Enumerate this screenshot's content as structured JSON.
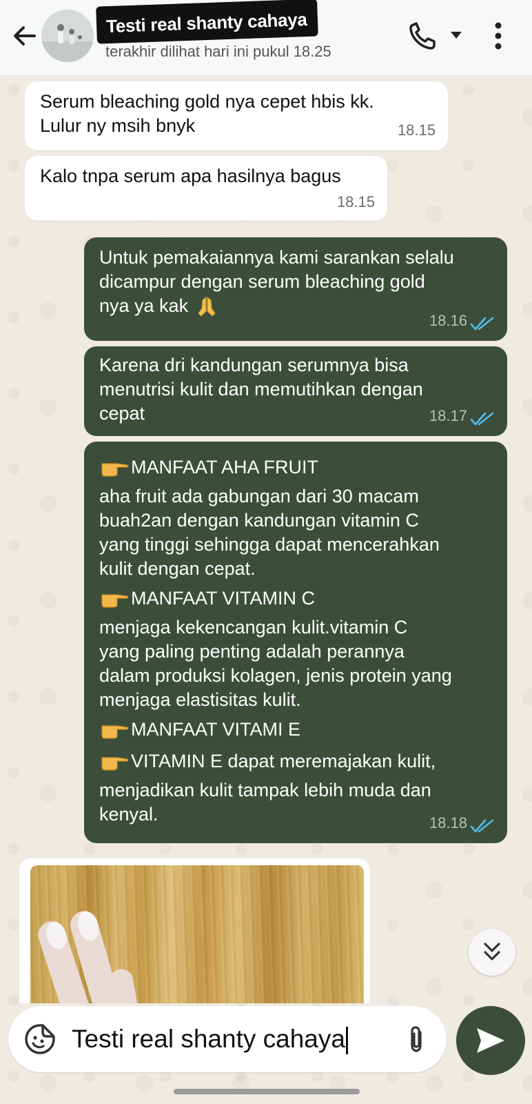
{
  "header": {
    "title": "Testi real shanty cahaya",
    "last_seen": "terakhir dilihat hari ini pukul 18.25"
  },
  "messages": [
    {
      "direction": "in",
      "text": "Serum bleaching gold nya cepet hbis kk.\nLulur ny msih bnyk",
      "time": "18.15"
    },
    {
      "direction": "in",
      "text": "Kalo tnpa serum apa hasilnya bagus",
      "time": "18.15"
    },
    {
      "direction": "out",
      "line1": "Untuk pemakaiannya kami sarankan selalu",
      "line2": "dicampur dengan serum bleaching gold",
      "line3": "nya ya kak",
      "time": "18.16",
      "status": "read"
    },
    {
      "direction": "out",
      "text": "Karena dri kandungan serumnya bisa\nmenutrisi kulit dan memutihkan dengan\ncepat",
      "time": "18.17",
      "status": "read"
    },
    {
      "direction": "out",
      "heading1": "MANFAAT AHA FRUIT",
      "para1": "aha fruit ada gabungan dari 30 macam\nbuah2an dengan kandungan vitamin C\nyang tinggi sehingga dapat mencerahkan\nkulit dengan cepat.",
      "heading2": "MANFAAT VITAMIN C",
      "para2": "menjaga kekencangan kulit.vitamin C\nyang paling penting adalah perannya\ndalam produksi kolagen, jenis protein yang\nmenjaga elastisitas kulit.",
      "heading3": "MANFAAT VITAMI E",
      "heading4": "VITAMIN E dapat meremajakan kulit,",
      "para4": "menjadikan kulit tampak lebih muda dan\nkenyal.",
      "time": "18.18",
      "status": "read"
    }
  ],
  "composer": {
    "value": "Testi real shanty cahaya"
  },
  "colors": {
    "outgoing_bubble": "#3c4e3a",
    "incoming_bubble": "#ffffff",
    "read_ticks": "#53bdeb",
    "send_button": "#3c4e3a"
  },
  "icons": [
    "back-arrow-icon",
    "avatar",
    "phone-icon",
    "dropdown-icon",
    "more-vert-icon",
    "praying-hands-emoji",
    "pointing-hand-emoji",
    "double-chevron-down-icon",
    "sticker-icon",
    "paperclip-icon",
    "send-icon"
  ]
}
